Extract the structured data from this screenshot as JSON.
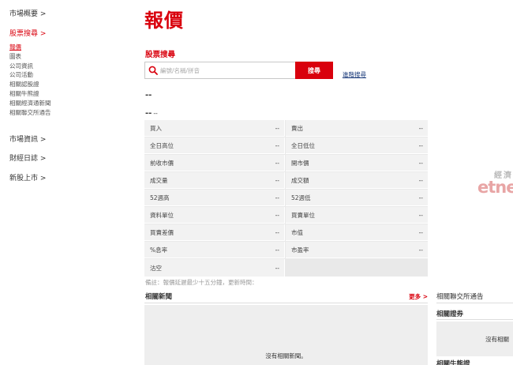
{
  "sidebar": {
    "market_overview": "市場概要 >",
    "stock_search": "股票搜尋 >",
    "sub_items": [
      "報價",
      "圖表",
      "公司資訊",
      "公司活動",
      "相關認股證",
      "相關牛熊證",
      "相關經濟通新聞",
      "相關聯交所通告"
    ],
    "market_info": "市場資訊 >",
    "finance_diary": "財經日誌 >",
    "new_listing": "新股上市 >"
  },
  "page": {
    "title": "報價"
  },
  "search": {
    "heading": "股票搜尋",
    "placeholder": "編號/名稱/拼音",
    "button_label": "搜尋",
    "advanced_label": "進階搜尋"
  },
  "stock": {
    "code": "--",
    "name": "--",
    "name_sub": "--"
  },
  "quote": {
    "rows": [
      {
        "left_label": "買入",
        "left_value": "--",
        "right_label": "賣出",
        "right_value": "--"
      },
      {
        "left_label": "全日高位",
        "left_value": "--",
        "right_label": "全日低位",
        "right_value": "--"
      },
      {
        "left_label": "前收市價",
        "left_value": "--",
        "right_label": "開市價",
        "right_value": "--"
      },
      {
        "left_label": "成交量",
        "left_value": "--",
        "right_label": "成交額",
        "right_value": "--"
      },
      {
        "left_label": "52週高",
        "left_value": "--",
        "right_label": "52週低",
        "right_value": "--"
      },
      {
        "left_label": "資料單位",
        "left_value": "--",
        "right_label": "買賣單位",
        "right_value": "--"
      },
      {
        "left_label": "買賣差價",
        "left_value": "--",
        "right_label": "市值",
        "right_value": "--"
      },
      {
        "left_label": "%息率",
        "left_value": "--",
        "right_label": "市盈率",
        "right_value": "--"
      }
    ],
    "last_row": {
      "left_label": "沽空",
      "left_value": "--"
    }
  },
  "disclaimer": "備註：報價延遲最少十五分鐘，更新時間：",
  "news": {
    "title": "相關新聞",
    "more_label": "更多 >",
    "empty_text": "沒有相關新聞。"
  },
  "right_column": {
    "logo_cn": "經濟",
    "logo_en": "etne",
    "hkex_notice": "相關聯交所通告",
    "warrants_title": "相關證券",
    "warrants_empty": "沒有相關",
    "cbbc_title": "相關牛熊證"
  },
  "colors": {
    "accent": "#d9000d",
    "link": "#1a3a7a",
    "table_bg": "#f2f2f2"
  }
}
